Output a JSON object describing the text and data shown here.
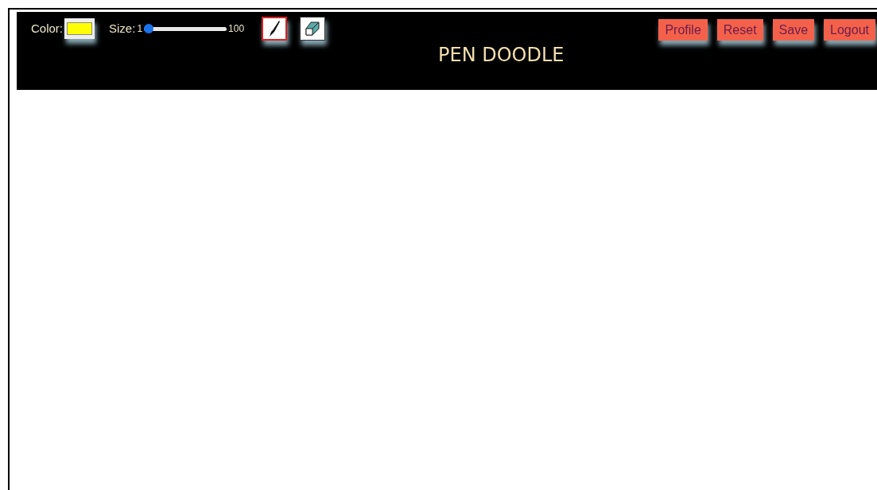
{
  "toolbar": {
    "color_label": "Color:",
    "color": "#ffff00",
    "size_label": "Size:",
    "size_min": "1",
    "size_max": "100",
    "size": {
      "level": 0
    },
    "tools": [
      {
        "kind": "brush",
        "selected": true
      },
      {
        "kind": "eraser",
        "selected": false
      }
    ]
  },
  "title": "PEN DOODLE",
  "buttons": [
    "Profile",
    "Reset",
    "Save",
    "Logout"
  ]
}
